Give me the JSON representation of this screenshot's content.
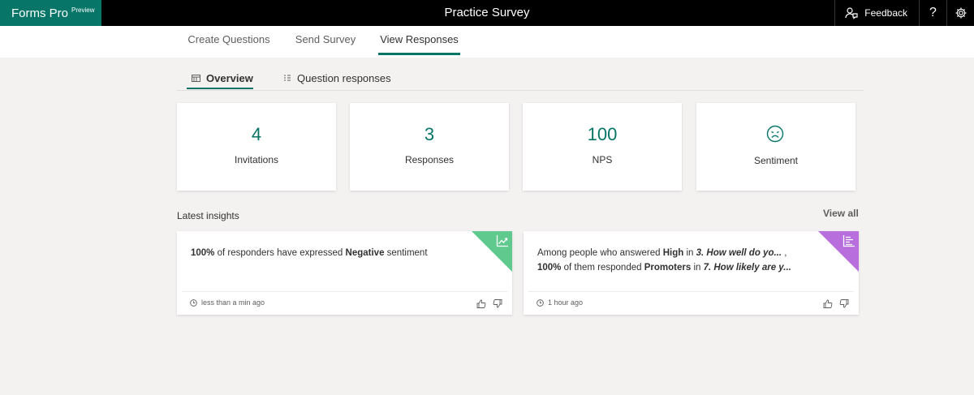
{
  "header": {
    "brand": "Forms Pro",
    "brand_badge": "Preview",
    "title": "Practice Survey",
    "feedback_label": "Feedback",
    "help_label": "?"
  },
  "main_tabs": [
    {
      "label": "Create Questions"
    },
    {
      "label": "Send Survey"
    },
    {
      "label": "View Responses",
      "active": true
    }
  ],
  "sub_tabs": [
    {
      "label": "Overview",
      "active": true
    },
    {
      "label": "Question responses"
    }
  ],
  "stats": [
    {
      "value": "4",
      "label": "Invitations"
    },
    {
      "value": "3",
      "label": "Responses"
    },
    {
      "value": "100",
      "label": "NPS"
    },
    {
      "label": "Sentiment",
      "icon": "sad-face-icon"
    }
  ],
  "insights_section": {
    "title": "Latest insights",
    "view_all": "View all"
  },
  "insights": [
    {
      "parts": [
        {
          "t": "100%",
          "s": "b"
        },
        {
          "t": " of responders have expressed "
        },
        {
          "t": "Negative",
          "s": "b"
        },
        {
          "t": " sentiment"
        }
      ],
      "time": "less than a min ago",
      "corner_color": "#5fc98e",
      "corner_icon": "trend-chart-icon"
    },
    {
      "line1": [
        {
          "t": "Among people who answered "
        },
        {
          "t": "High",
          "s": "b"
        },
        {
          "t": " in "
        },
        {
          "t": "3. How well do yo...",
          "s": "q"
        },
        {
          "t": " ,"
        }
      ],
      "line2": [
        {
          "t": "100%",
          "s": "b"
        },
        {
          "t": " of them responded "
        },
        {
          "t": "Promoters",
          "s": "b"
        },
        {
          "t": " in "
        },
        {
          "t": "7. How likely are y...",
          "s": "q"
        }
      ],
      "time": "1 hour ago",
      "corner_color": "#b86fdd",
      "corner_icon": "bar-chart-icon"
    }
  ],
  "colors": {
    "brand": "#077568",
    "accent": "#077568",
    "background": "#f3f2f1"
  }
}
